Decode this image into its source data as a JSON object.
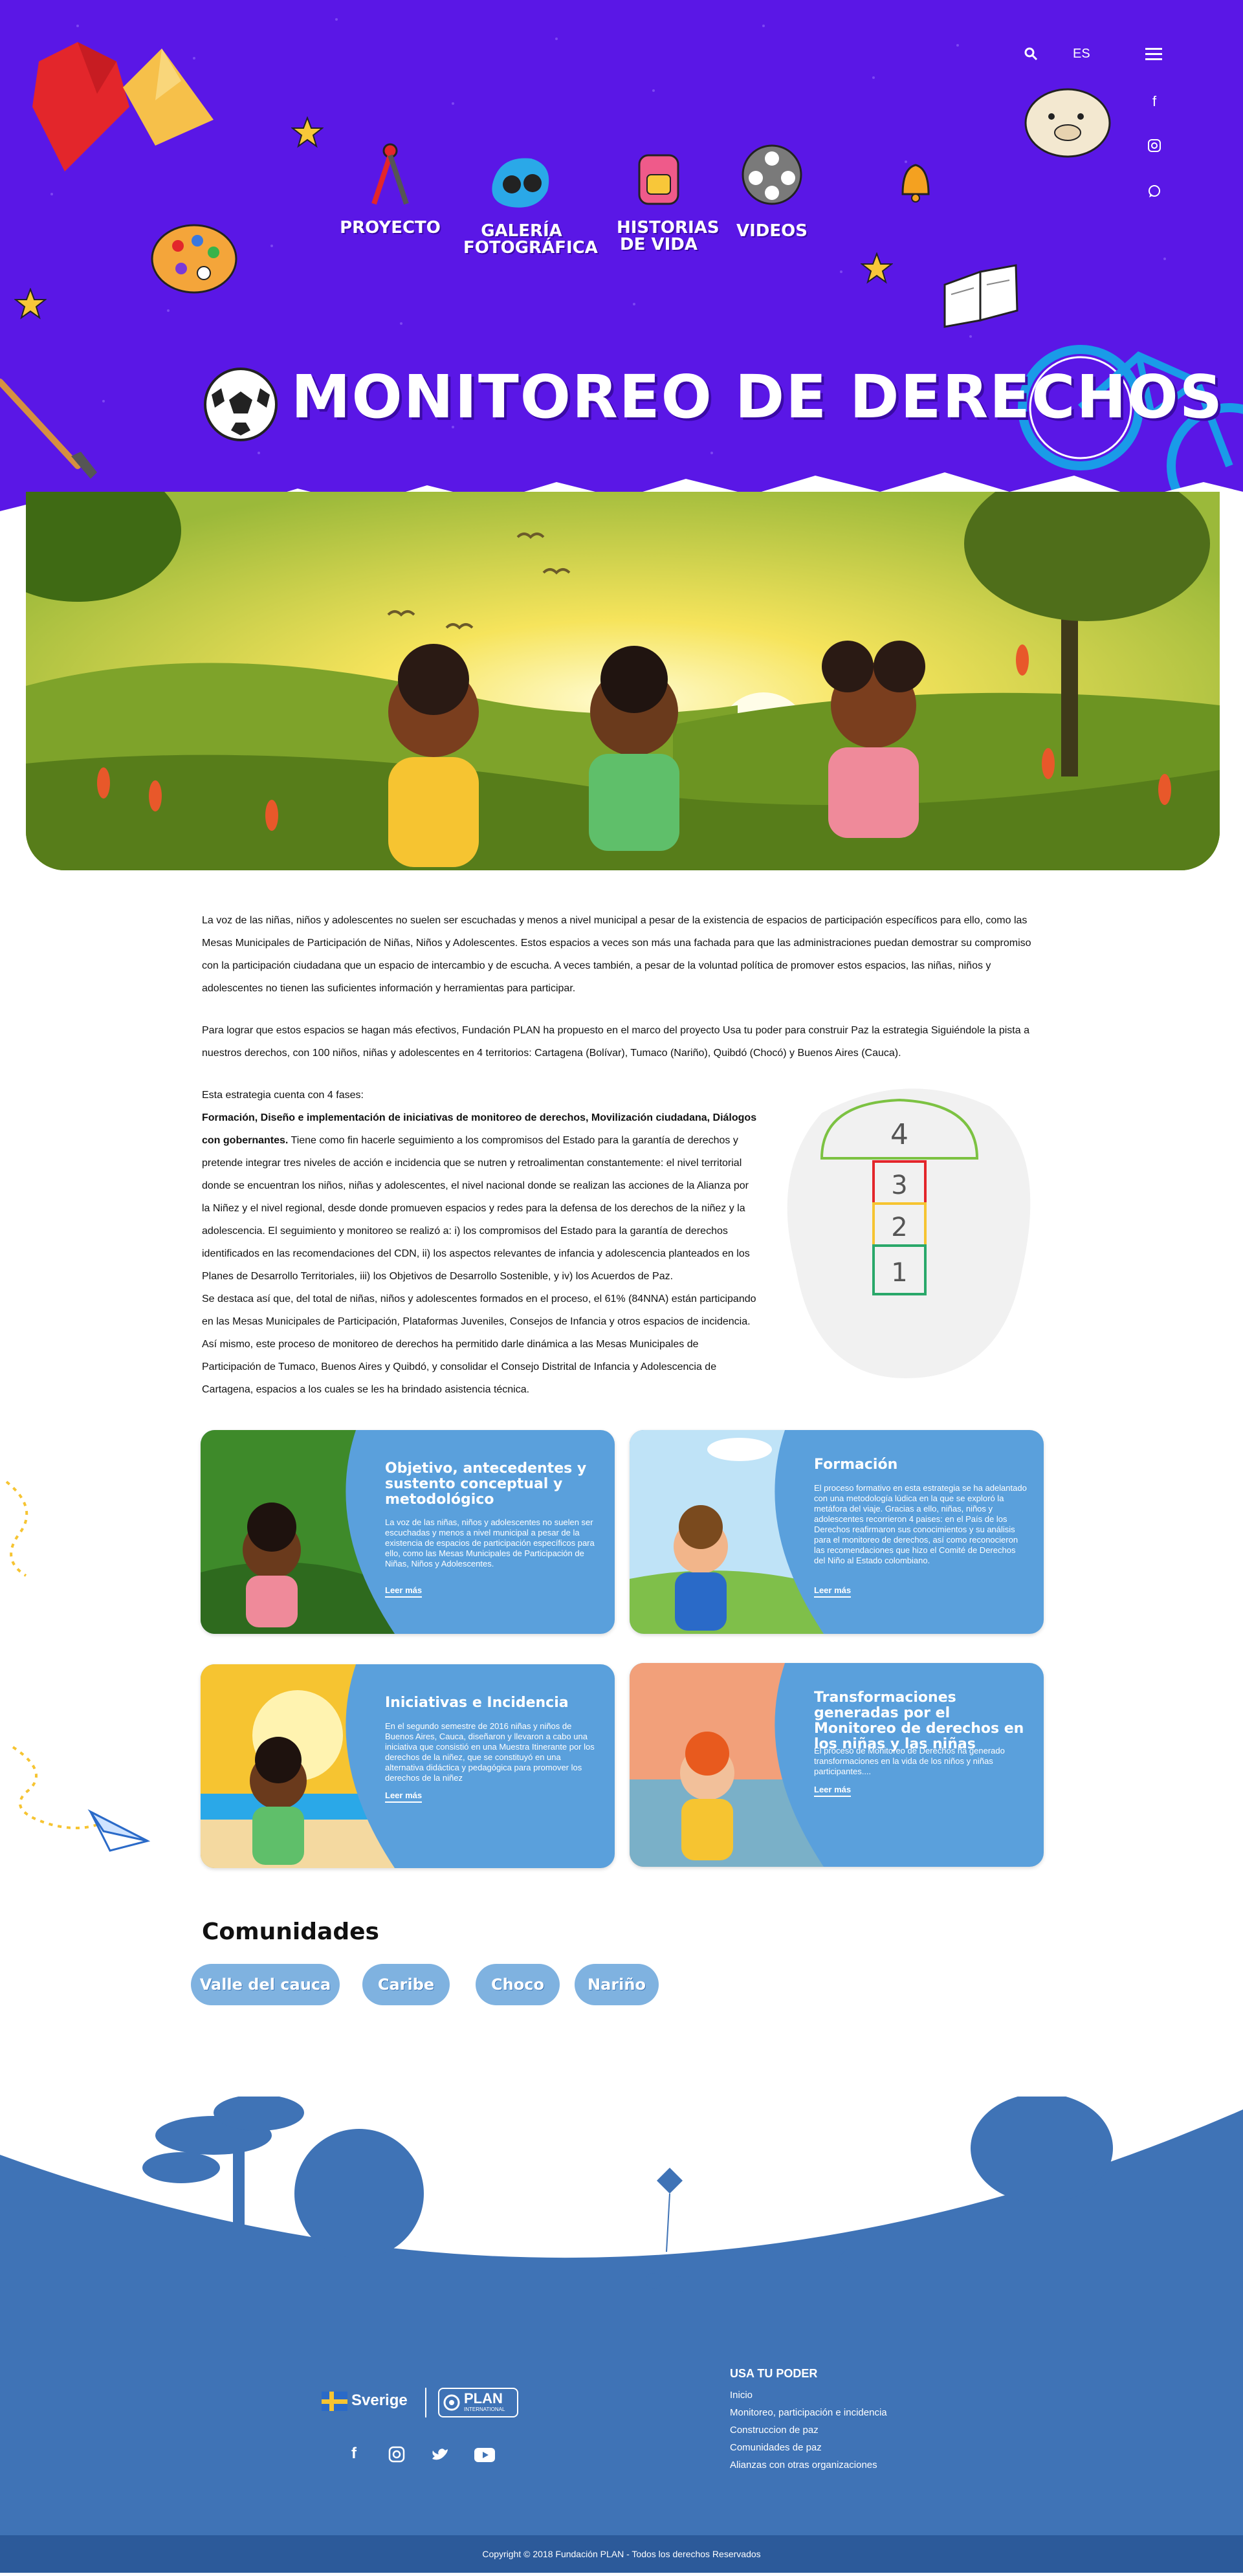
{
  "topbar": {
    "language": "ES",
    "social": [
      "facebook-icon",
      "instagram-icon",
      "whatsapp-icon"
    ]
  },
  "nav": {
    "items": [
      {
        "label": "PROYECTO"
      },
      {
        "label": "GALERÍA FOTOGRÁFICA"
      },
      {
        "label": "HISTORIAS DE VIDA"
      },
      {
        "label": "VIDEOS"
      }
    ]
  },
  "page": {
    "title": "MONITOREO DE DERECHOS"
  },
  "intro": {
    "p1": "La voz de las niñas, niños y adolescentes no suelen ser escuchadas y menos a nivel municipal a pesar de la existencia de espacios de participación específicos para ello, como las Mesas Municipales de Participación de Niñas, Niños y Adolescentes. Estos espacios a veces son más una fachada para que las administraciones puedan demostrar su compromiso con la participación ciudadana que un espacio de intercambio y de escucha. A veces también, a pesar de la voluntad política de promover estos espacios, las niñas, niños y adolescentes no tienen las suficientes información y herramientas para participar.",
    "p2": "Para lograr que estos espacios se hagan más efectivos, Fundación PLAN ha propuesto en el marco del proyecto Usa tu poder para construir Paz la estrategia Siguiéndole la pista a nuestros derechos, con 100 niños, niñas y adolescentes en 4 territorios: Cartagena (Bolívar), Tumaco (Nariño), Quibdó (Chocó) y Buenos Aires (Cauca).",
    "p3_lead": "Esta estrategia cuenta con 4 fases:",
    "p3_bold": "Formación, Diseño e implementación de iniciativas de monitoreo de derechos, Movilización ciudadana, Diálogos con gobernantes.",
    "p3_rest": " Tiene como fin hacerle seguimiento a los compromisos del Estado para la garantía de derechos y pretende integrar tres niveles de acción e incidencia que se nutren y retroalimentan constantemente: el nivel territorial donde se encuentran los niños, niñas y adolescentes, el nivel nacional donde se realizan las acciones de la Alianza por la Niñez y el nivel regional, desde donde promueven espacios y redes para la defensa de los derechos de la niñez y la adolescencia. El seguimiento y monitoreo se realizó a: i) los compromisos del Estado para la garantía de derechos identificados en las recomendaciones del CDN, ii) los aspectos relevantes de infancia y adolescencia planteados en los Planes de Desarrollo Territoriales, iii) los Objetivos de Desarrollo Sostenible, y iv) los Acuerdos de Paz.",
    "p4": "Se destaca así que, del total de niñas, niños y adolescentes formados en el proceso, el 61% (84NNA) están participando en las Mesas Municipales de Participación, Plataformas Juveniles, Consejos de Infancia y otros espacios de incidencia. Así mismo, este proceso de monitoreo de derechos ha permitido darle dinámica a las Mesas Municipales de Participación de Tumaco, Buenos Aires y Quibdó, y consolidar el Consejo Distrital de Infancia y Adolescencia de Cartagena, espacios a los cuales se les ha brindado asistencia técnica."
  },
  "hopscotch": {
    "numbers": [
      "4",
      "3",
      "2",
      "1"
    ]
  },
  "cards": [
    {
      "title": "Objetivo, antecedentes y sustento conceptual y metodológico",
      "text": "La voz de las niñas, niños y adolescentes no suelen ser escuchadas y menos a nivel municipal a pesar de la existencia de espacios de participación específicos para ello, como las Mesas Municipales de Participación de Niñas, Niños y Adolescentes.",
      "link": "Leer más"
    },
    {
      "title": "Formación",
      "text": "El proceso formativo en esta estrategia se ha adelantado con una metodología lúdica en la que se exploró la metáfora del viaje. Gracias a ello, niñas, niños y adolescentes recorrieron 4 paises: en el País de los Derechos reafirmaron sus conocimientos y su análisis para el monitoreo de derechos, así como reconocieron las recomendaciones que hizo el Comité de Derechos del Niño al Estado colombiano.",
      "link": "Leer más"
    },
    {
      "title": "Iniciativas e Incidencia",
      "text": "En el segundo semestre de 2016 niñas y niños de Buenos Aires, Cauca, diseñaron y llevaron a cabo una iniciativa que consistió en una Muestra Itinerante por los derechos de la niñez, que se constituyó en una alternativa didáctica y pedagógica para promover los derechos de la niñez",
      "link": "Leer más"
    },
    {
      "title": "Transformaciones generadas por el Monitoreo de derechos en los niñas y las niñas",
      "text": "El proceso de Monitoreo de Derechos ha generado transformaciones en la vida de los niños y niñas participantes....",
      "link": "Leer más"
    }
  ],
  "communities": {
    "title": "Comunidades",
    "items": [
      "Valle del cauca",
      "Caribe",
      "Choco",
      "Nariño"
    ]
  },
  "footer": {
    "sweden": "Sverige",
    "plan": "PLAN",
    "plan_sub": "INTERNATIONAL",
    "social": [
      "facebook-icon",
      "instagram-icon",
      "twitter-icon",
      "youtube-icon"
    ],
    "links_title": "USA TU PODER",
    "links": [
      "Inicio",
      "Monitoreo, participación e incidencia",
      "Construccion de paz",
      "Comunidades de paz",
      "Alianzas con otras organizaciones"
    ],
    "copyright": "Copyright © 2018 Fundación PLAN - Todos los derechos Reservados"
  },
  "colors": {
    "header_purple": "#5a17e6",
    "card_blue": "#5aa0dc",
    "footer_blue": "#3f73b6"
  }
}
